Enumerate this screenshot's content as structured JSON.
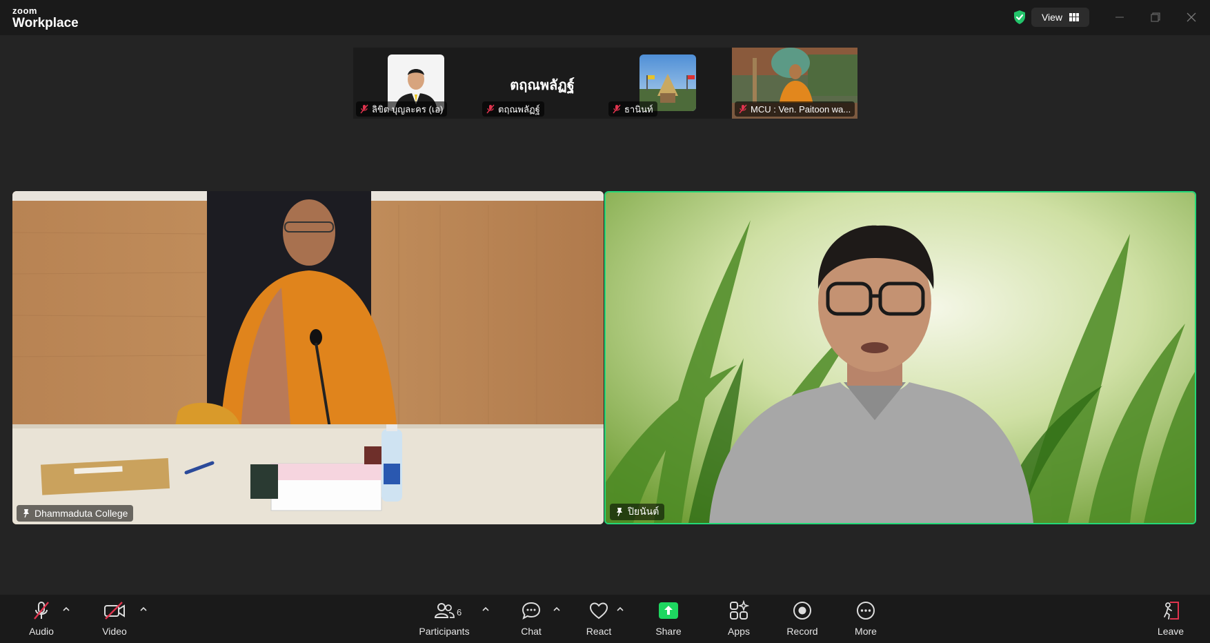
{
  "app": {
    "brand_top": "zoom",
    "brand_main": "Workplace"
  },
  "titlebar": {
    "view_label": "View"
  },
  "thumbnails": [
    {
      "name": "ลิขิต บุญละคร (เอ)",
      "muted": true
    },
    {
      "name": "ตฤณพลัฏฐ์",
      "display_name": "ตฤณพลัฏฐ์",
      "muted": true
    },
    {
      "name": "ธานินท์",
      "muted": true
    },
    {
      "name": "MCU : Ven. Paitoon wa...",
      "muted": true
    }
  ],
  "tiles": [
    {
      "name": "Dhammaduta College"
    },
    {
      "name": "ปิยนันต์",
      "active_speaker": true
    }
  ],
  "toolbar": {
    "audio": "Audio",
    "video": "Video",
    "participants": "Participants",
    "participants_count": "6",
    "chat": "Chat",
    "react": "React",
    "share": "Share",
    "apps": "Apps",
    "record": "Record",
    "more": "More",
    "leave": "Leave"
  },
  "colors": {
    "accent_green": "#23d978",
    "share_green": "#1ed760",
    "muted_red": "#e0344e",
    "leave_red": "#e0344e"
  }
}
